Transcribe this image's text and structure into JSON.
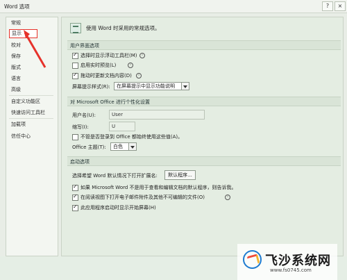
{
  "window": {
    "title": "Word 选项",
    "buttons": {
      "help": "?",
      "close": "×"
    }
  },
  "sidebar": {
    "items": [
      {
        "label": "常规",
        "selected": false
      },
      {
        "label": "显示",
        "selected": true
      },
      {
        "label": "校对",
        "selected": false
      },
      {
        "label": "保存",
        "selected": false
      },
      {
        "label": "版式",
        "selected": false
      },
      {
        "label": "语言",
        "selected": false
      },
      {
        "label": "高级",
        "selected": false
      },
      {
        "label": "自定义功能区",
        "selected": false
      },
      {
        "label": "快速访问工具栏",
        "selected": false
      },
      {
        "label": "加载项",
        "selected": false
      },
      {
        "label": "信任中心",
        "selected": false
      }
    ]
  },
  "main": {
    "header": "使用 Word 时采用的常规选项。",
    "sections": {
      "ui": "用户界面选项",
      "personalize": "对 Microsoft Office 进行个性化设置",
      "startup": "启动选项"
    },
    "ui_options": {
      "mini_toolbar": "选择时显示浮动工具栏(M)",
      "live_preview": "启用实时预览(L)",
      "update_while_dragging": "拖动时更新文档内容(D)",
      "screen_tip_label": "屏幕提示样式(R):",
      "screen_tip_value": "在屏幕提示中显示功能说明"
    },
    "personalize": {
      "username_label": "用户名(U):",
      "username_value": "User",
      "initials_label": "缩写(I):",
      "initials_value": "U",
      "always_use_label": "不管是否登录到 Office 都始终使用这些值(A)。",
      "theme_label": "Office 主题(T):",
      "theme_value": "白色"
    },
    "startup": {
      "extensions_label": "选择希望 Word 默认情况下打开扩展名:",
      "default_programs_button": "默认程序...",
      "tell_me_default": "如果 Microsoft Word 不是用于查看和编辑文档的默认程序，则告诉我。",
      "open_attachments": "在阅读视图下打开电子邮件附件及其他不可编辑的文件(O)",
      "show_start_screen": "此应用程序启动时显示开始屏幕(H)"
    }
  },
  "watermark": {
    "name": "飞沙系统网",
    "url": "www.fs0745.com"
  },
  "colors": {
    "highlight": "#e6322b",
    "arrow": "#e6322b",
    "section_bg": "#d9e4d7"
  }
}
